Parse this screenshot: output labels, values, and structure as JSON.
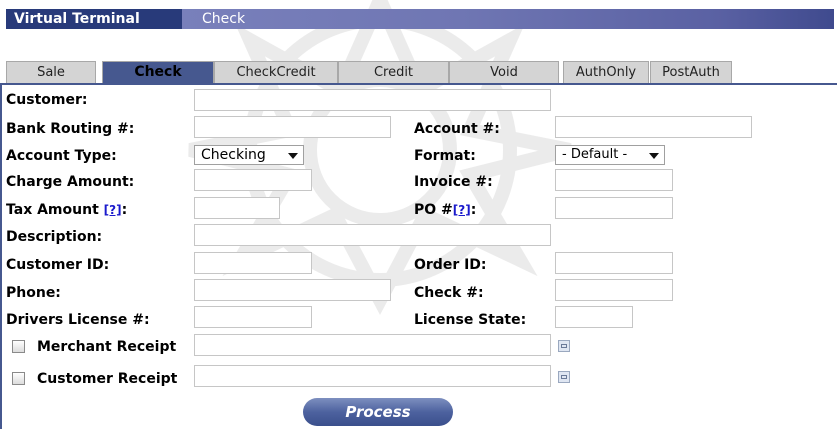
{
  "header": {
    "title": "Virtual Terminal",
    "subtitle": "Check"
  },
  "tabs": [
    "Sale",
    "Check",
    "CheckCredit",
    "Credit",
    "Void",
    "AuthOnly",
    "PostAuth"
  ],
  "active_tab": "Check",
  "form": {
    "customer_label": "Customer:",
    "bank_routing_label": "Bank Routing #:",
    "account_label": "Account #:",
    "account_type_label": "Account Type:",
    "account_type_value": "Checking",
    "format_label": "Format:",
    "format_value": "- Default -",
    "charge_amount_label": "Charge Amount:",
    "invoice_label": "Invoice #:",
    "tax_amount_label": "Tax Amount",
    "help_link": "[?]",
    "colon": ":",
    "po_label": "PO #",
    "description_label": "Description:",
    "customer_id_label": "Customer ID:",
    "order_id_label": "Order ID:",
    "phone_label": "Phone:",
    "check_label": "Check #:",
    "drivers_license_label": "Drivers License #:",
    "license_state_label": "License State:",
    "merchant_receipt_label": "Merchant Receipt",
    "customer_receipt_label": "Customer Receipt"
  },
  "process_button": "Process"
}
